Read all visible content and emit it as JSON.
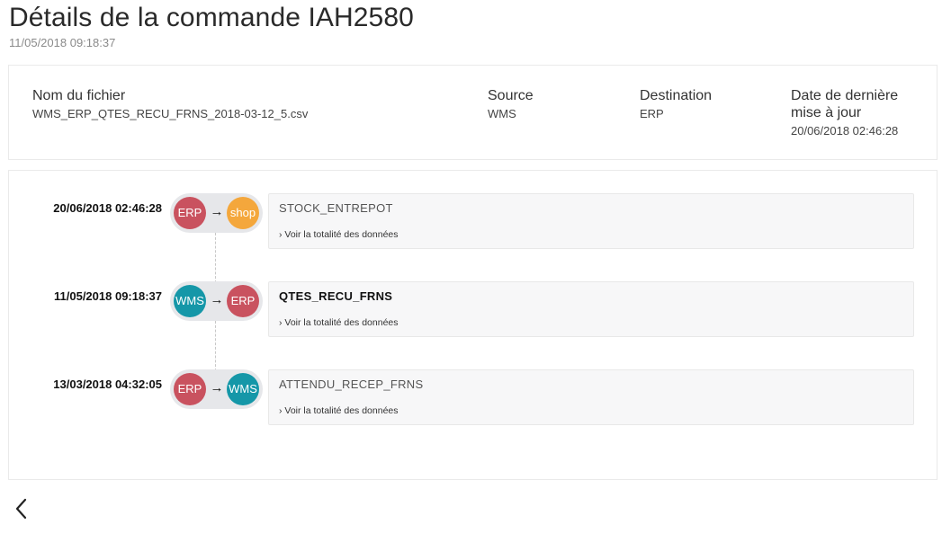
{
  "header": {
    "title": "Détails de la commande IAH2580",
    "subtitle": "11/05/2018 09:18:37"
  },
  "info": {
    "file_label": "Nom du fichier",
    "file_value": "WMS_ERP_QTES_RECU_FRNS_2018-03-12_5.csv",
    "source_label": "Source",
    "source_value": "WMS",
    "destination_label": "Destination",
    "destination_value": "ERP",
    "updated_label": "Date de dernière mise à jour",
    "updated_value": "20/06/2018 02:46:28"
  },
  "timeline": {
    "entries": [
      {
        "date": "20/06/2018 02:46:28",
        "from": "ERP",
        "to": "shop",
        "arrow": "→",
        "title": "STOCK_ENTREPOT",
        "link": "› Voir la totalité des données"
      },
      {
        "date": "11/05/2018 09:18:37",
        "from": "WMS",
        "to": "ERP",
        "arrow": "→",
        "title": "QTES_RECU_FRNS",
        "link": "› Voir la totalité des données"
      },
      {
        "date": "13/03/2018 04:32:05",
        "from": "ERP",
        "to": "WMS",
        "arrow": "→",
        "title": "ATTENDU_RECEP_FRNS",
        "link": "› Voir la totalité des données"
      }
    ]
  },
  "colors": {
    "erp": "#c9525f",
    "wms": "#1597a8",
    "shop": "#f4a73c"
  },
  "icons": {
    "back": "chevron-left-icon"
  }
}
